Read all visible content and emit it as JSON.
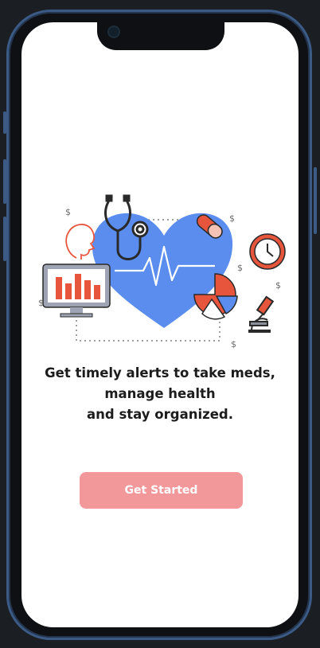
{
  "onboarding": {
    "lines": [
      "Get timely alerts to take meds,",
      "manage health",
      "and stay organized."
    ],
    "button_label": "Get Started"
  },
  "illustration": {
    "icons": [
      "heart-icon",
      "stethoscope-icon",
      "pill-icon",
      "clock-icon",
      "pie-chart-icon",
      "microscope-icon",
      "monitor-chart-icon",
      "head-profile-icon",
      "dollar-icon"
    ]
  },
  "colors": {
    "button": "#f2989b",
    "heart": "#5b8def",
    "accent_red": "#e8553d",
    "frame": "#3b5b86"
  }
}
